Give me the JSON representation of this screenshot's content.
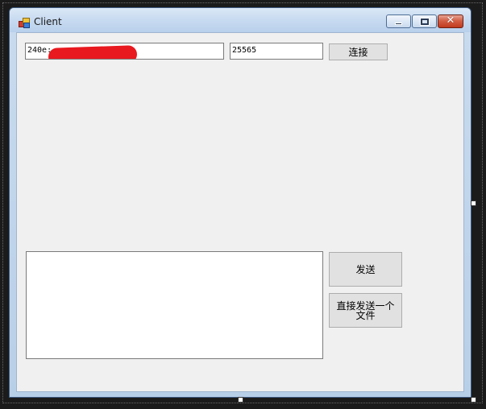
{
  "window": {
    "title": "Client",
    "minimize_icon": "minimize-icon",
    "maximize_icon": "maximize-icon",
    "close_glyph": "✕"
  },
  "connection": {
    "address_value": "240e:",
    "port_value": "25565",
    "connect_label": "连接"
  },
  "message": {
    "value": "",
    "send_label": "发送",
    "send_file_label": "直接发送一个文件"
  },
  "colors": {
    "redaction": "#e8191f",
    "close_button": "#c13a1e"
  }
}
